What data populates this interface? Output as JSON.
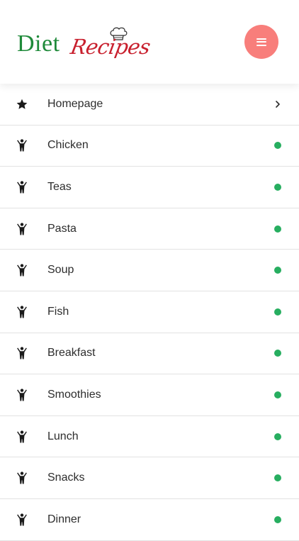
{
  "header": {
    "logo": {
      "word1": "Diet",
      "word2": "Recipes",
      "word1_color": "#1f8a3a",
      "word2_color": "#c8202e",
      "decoration_icon": "chef-hat-icon"
    },
    "menu_button": {
      "icon": "hamburger-menu-icon",
      "color": "#f87e7b"
    }
  },
  "menu": {
    "items": [
      {
        "label": "Homepage",
        "icon": "star-icon",
        "indicator": "chevron-right"
      },
      {
        "label": "Chicken",
        "icon": "person-icon",
        "indicator": "status-dot"
      },
      {
        "label": "Teas",
        "icon": "person-icon",
        "indicator": "status-dot"
      },
      {
        "label": "Pasta",
        "icon": "person-icon",
        "indicator": "status-dot"
      },
      {
        "label": "Soup",
        "icon": "person-icon",
        "indicator": "status-dot"
      },
      {
        "label": "Fish",
        "icon": "person-icon",
        "indicator": "status-dot"
      },
      {
        "label": "Breakfast",
        "icon": "person-icon",
        "indicator": "status-dot"
      },
      {
        "label": "Smoothies",
        "icon": "person-icon",
        "indicator": "status-dot"
      },
      {
        "label": "Lunch",
        "icon": "person-icon",
        "indicator": "status-dot"
      },
      {
        "label": "Snacks",
        "icon": "person-icon",
        "indicator": "status-dot"
      },
      {
        "label": "Dinner",
        "icon": "person-icon",
        "indicator": "status-dot"
      }
    ],
    "dot_color": "#27ae60"
  }
}
